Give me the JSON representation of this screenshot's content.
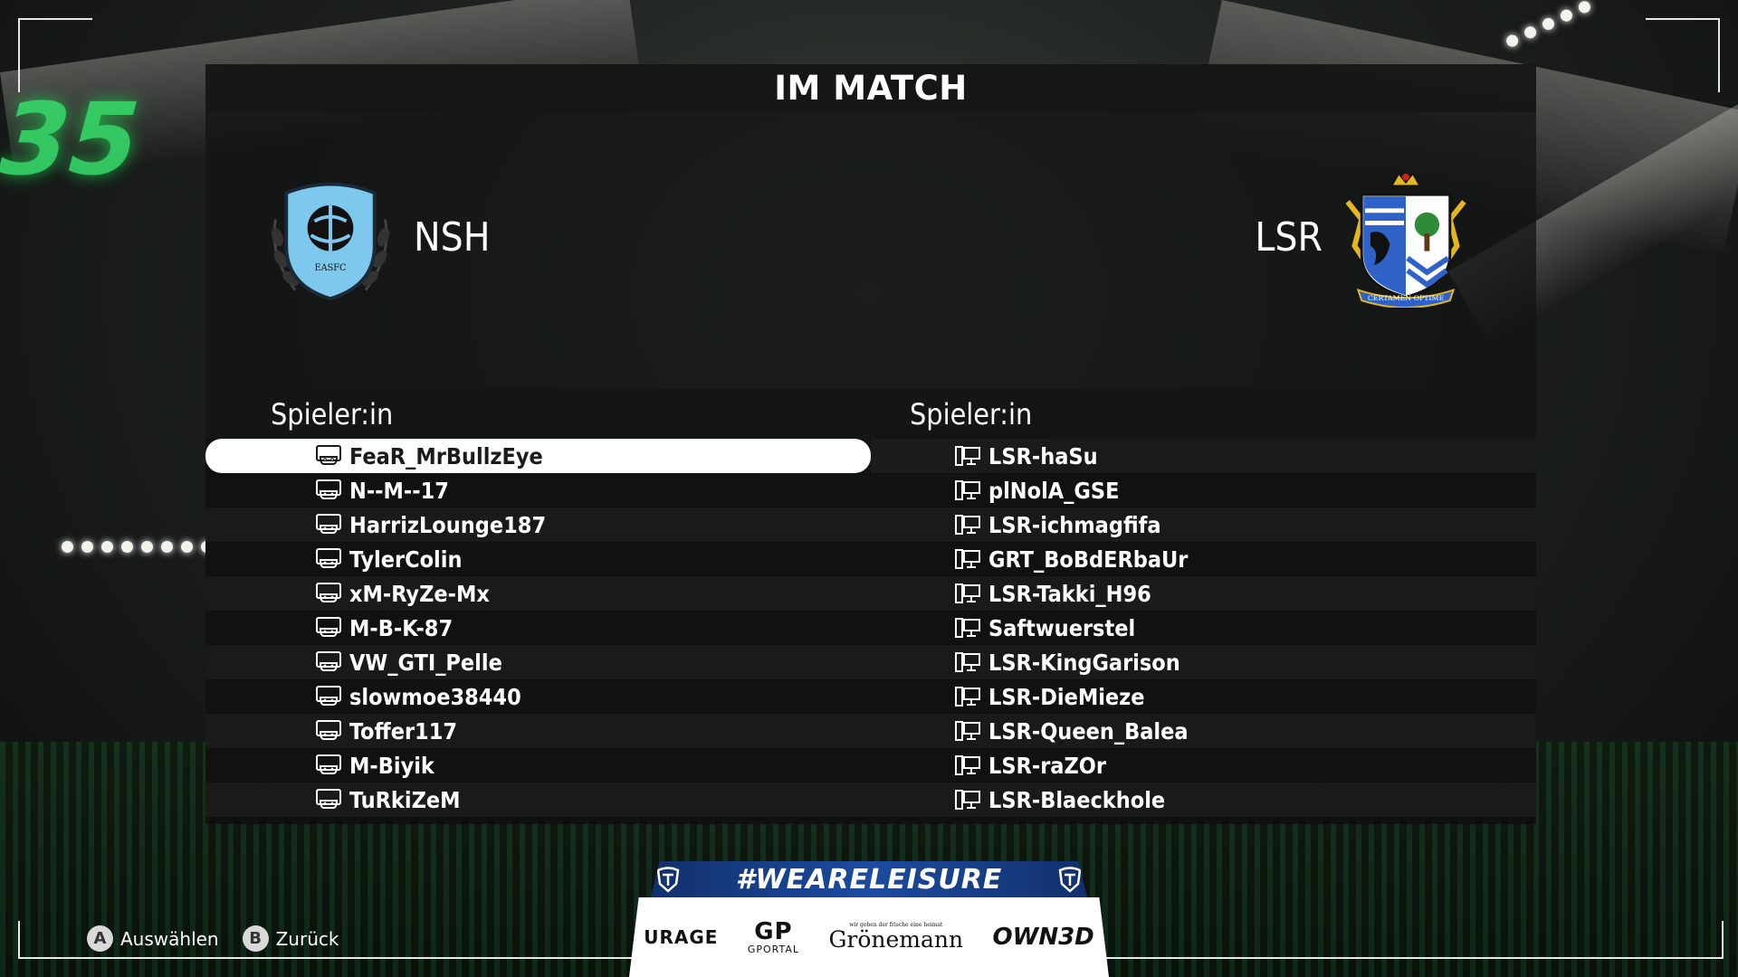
{
  "title": "IM MATCH",
  "teams": {
    "home": {
      "name": "NSH",
      "crest_text": "EASFC",
      "color": "#7ec8ee"
    },
    "away": {
      "name": "LSR",
      "crest_text": "CERTAMEN OPTIME",
      "color": "#2f62c8"
    }
  },
  "lists": {
    "home": {
      "header": "Spieler:in",
      "platform_icon": "console-icon",
      "players": [
        "FeaR_MrBullzEye",
        "N--M--17",
        "HarrizLounge187",
        "TylerColin",
        "xM-RyZe-Mx",
        "M-B-K-87",
        "VW_GTI_Pelle",
        "slowmoe38440",
        "Toffer117",
        "M-Biyik",
        "TuRkiZeM"
      ]
    },
    "away": {
      "header": "Spieler:in",
      "platform_icon": "pc-icon",
      "players": [
        "LSR-haSu",
        "plNolA_GSE",
        "LSR-ichmagfifa",
        "GRT_BoBdERbaUr",
        "LSR-Takki_H96",
        "Saftwuerstel",
        "LSR-KingGarison",
        "LSR-DieMieze",
        "LSR-Queen_Balea",
        "LSR-raZOr",
        "LSR-Blaeckhole"
      ]
    }
  },
  "banner": {
    "hashtag": "#WEARELEISURE",
    "sponsors": {
      "urage": "URAGE",
      "gportal_mark": "GP",
      "gportal": "GPORTAL",
      "gronemann_tag": "wir geben der frische eine heimat",
      "gronemann": "Grönemann",
      "own3d": "OWN3D"
    }
  },
  "hints": {
    "select_key": "A",
    "select_label": "Auswählen",
    "back_key": "B",
    "back_label": "Zurück"
  },
  "colors": {
    "accent_green": "#36e26c",
    "selected_row": "#ffffff",
    "banner_blue": "#1c4ba0"
  }
}
